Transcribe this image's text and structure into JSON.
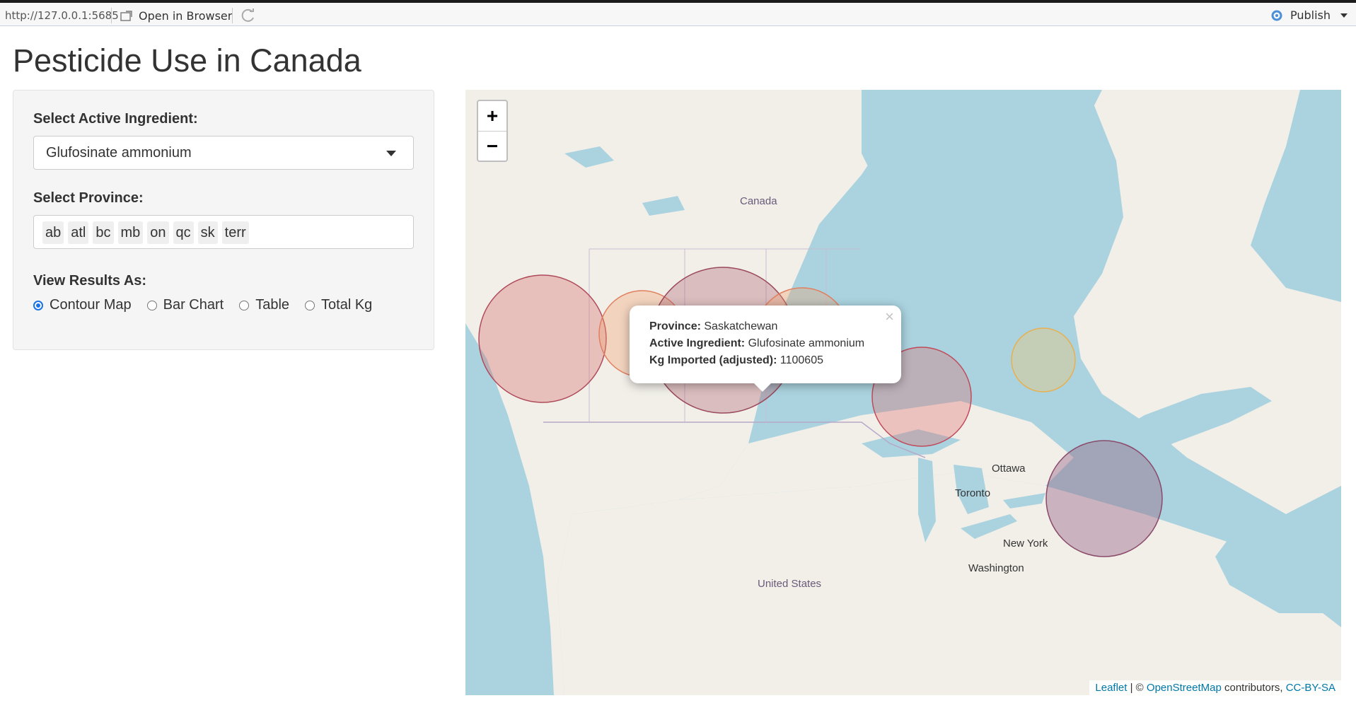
{
  "browser": {
    "url": "http://127.0.0.1:5685",
    "open_in_browser": "Open in Browser",
    "publish": "Publish"
  },
  "page": {
    "title": "Pesticide Use in Canada"
  },
  "sidebar": {
    "ingredient_label": "Select Active Ingredient:",
    "ingredient_value": "Glufosinate ammonium",
    "province_label": "Select Province:",
    "province_tags": [
      "ab",
      "atl",
      "bc",
      "mb",
      "on",
      "qc",
      "sk",
      "terr"
    ],
    "view_label": "View Results As:",
    "view_options": [
      "Contour Map",
      "Bar Chart",
      "Table",
      "Total Kg"
    ],
    "view_selected": "Contour Map"
  },
  "map": {
    "zoom_in": "+",
    "zoom_out": "−",
    "place_labels": {
      "canada": "Canada",
      "ottawa": "Ottawa",
      "toronto": "Toronto",
      "new_york": "New York",
      "washington": "Washington",
      "united_states": "United States"
    },
    "popup": {
      "province_key": "Province:",
      "province_value": "Saskatchewan",
      "ingredient_key": "Active Ingredient:",
      "ingredient_value": "Glufosinate ammonium",
      "kg_key": "Kg Imported (adjusted):",
      "kg_value": "1100605",
      "close": "×"
    },
    "attribution": {
      "leaflet": "Leaflet",
      "sep": " | © ",
      "osm": "OpenStreetMap",
      "contributors": " contributors, ",
      "license": "CC-BY-SA"
    },
    "colors": {
      "water": "#aad3df",
      "land": "#f2efe9",
      "circle_red": "#d46a6a",
      "circle_orange": "#f0a070",
      "circle_yellow": "#f6c56a"
    }
  }
}
